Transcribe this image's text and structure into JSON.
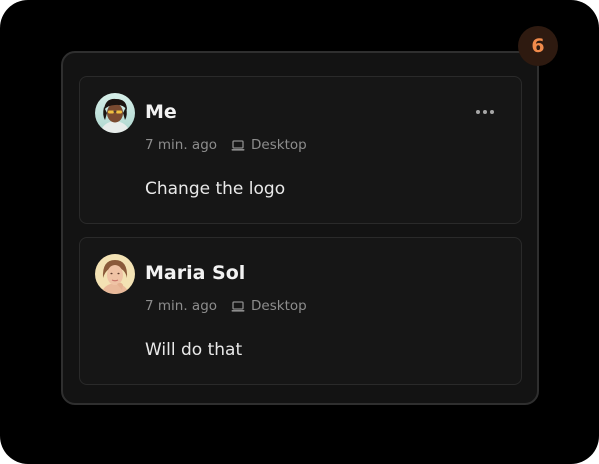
{
  "notification_badge": {
    "count": "6"
  },
  "comments": [
    {
      "author": "Me",
      "time": "7 min. ago",
      "device": "Desktop",
      "device_icon": "laptop-icon",
      "message": "Change the logo",
      "has_menu": true
    },
    {
      "author": "Maria Sol",
      "time": "7 min. ago",
      "device": "Desktop",
      "device_icon": "laptop-icon",
      "message": "Will do that",
      "has_menu": false
    }
  ],
  "colors": {
    "badge_text": "#f08a4b",
    "badge_bg": "#2e1a10",
    "panel_bg": "#131313",
    "card_bg": "#161616",
    "text_primary": "#f2f2f2",
    "text_secondary": "#8d8d8d"
  }
}
